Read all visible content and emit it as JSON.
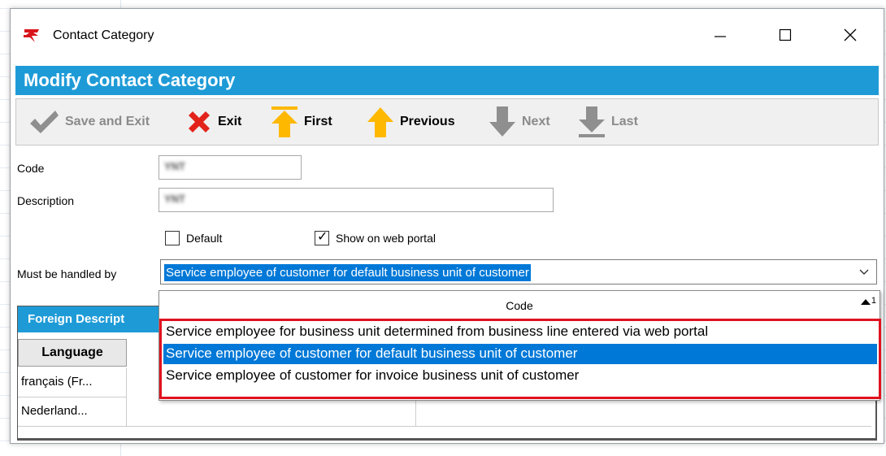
{
  "window": {
    "title": "Contact Category",
    "header": "Modify Contact Category"
  },
  "toolbar": {
    "save_exit": "Save and Exit",
    "exit": "Exit",
    "first": "First",
    "previous": "Previous",
    "next": "Next",
    "last": "Last"
  },
  "form": {
    "code_label": "Code",
    "code_value": "YNT",
    "description_label": "Description",
    "description_value": "YNT",
    "default_label": "Default",
    "default_checked": false,
    "web_portal_label": "Show on web portal",
    "web_portal_checked": true,
    "handled_by_label": "Must be handled by",
    "handled_by_value": "Service employee of customer for default business unit of customer"
  },
  "dropdown": {
    "column_header": "Code",
    "sort_indicator": "1",
    "options": [
      "Service employee for business unit determined from business line entered via web portal",
      "Service employee of customer for default business unit of customer",
      "Service employee of customer for invoice business unit of customer"
    ],
    "selected_index": 1
  },
  "foreign_descriptions": {
    "header": "Foreign Descript",
    "column_language": "Language",
    "rows": [
      {
        "language": "français (Fr..."
      },
      {
        "language": "Nederland..."
      }
    ]
  },
  "colors": {
    "header_blue": "#1e9bd7",
    "selection_blue": "#0078d7",
    "highlight_red": "#e0121f"
  }
}
